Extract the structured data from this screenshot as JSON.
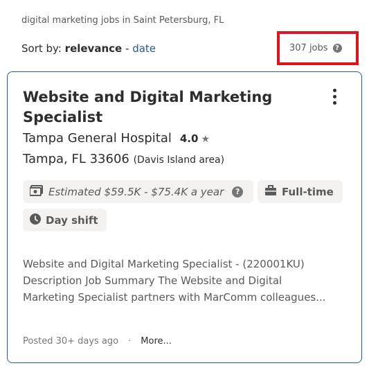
{
  "search": {
    "caption": "digital marketing jobs in Saint Petersburg, FL"
  },
  "sort": {
    "label": "Sort by:",
    "active": "relevance",
    "separator": "-",
    "alternate": "date"
  },
  "job_count": "307 jobs",
  "job": {
    "title_line1": "Website and Digital Marketing",
    "title_line2": "Specialist",
    "company": "Tampa General Hospital",
    "rating": "4.0",
    "location": "Tampa, FL 33606",
    "area": "(Davis Island area)",
    "salary": "Estimated $59.5K - $75.4K a year",
    "job_type": "Full-time",
    "shift": "Day shift",
    "description": "Website and Digital Marketing Specialist - (220001KU) Description Job Summary The Website and Digital Marketing Specialist partners with MarComm colleagues...",
    "posted": "Posted 30+ days ago",
    "more": "More..."
  },
  "colors": {
    "accent": "#2557a7",
    "highlight_box": "#e0141e",
    "tag_bg": "#f3f2f1"
  },
  "icons": [
    "help-icon",
    "kebab-menu-icon",
    "star-icon",
    "salary-icon",
    "briefcase-icon",
    "clock-icon"
  ]
}
